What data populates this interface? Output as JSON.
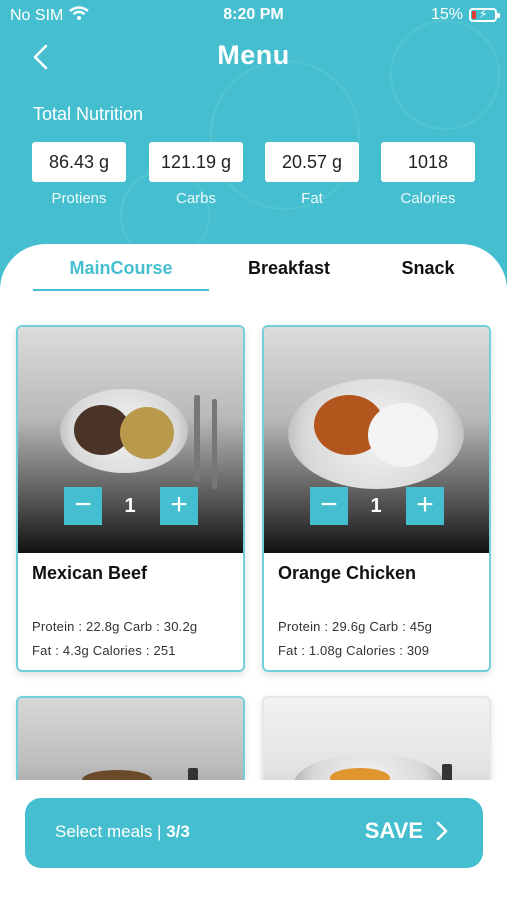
{
  "status_bar": {
    "carrier": "No SIM",
    "time": "8:20 PM",
    "battery": "15%"
  },
  "header": {
    "title": "Menu",
    "nutrition_heading": "Total Nutrition",
    "nutrition": [
      {
        "value": "86.43 g",
        "label": "Protiens"
      },
      {
        "value": "121.19 g",
        "label": "Carbs"
      },
      {
        "value": "20.57 g",
        "label": "Fat"
      },
      {
        "value": "1018",
        "label": "Calories"
      }
    ]
  },
  "tabs": [
    {
      "label": "MainCourse",
      "active": true
    },
    {
      "label": "Breakfast",
      "active": false
    },
    {
      "label": "Snack",
      "active": false
    }
  ],
  "meals": [
    {
      "name": "Mexican Beef",
      "quantity": "1",
      "info_line1": "Protein : 22.8g  Carb : 30.2g",
      "info_line2": "Fat : 4.3g  Calories : 251"
    },
    {
      "name": "Orange Chicken",
      "quantity": "1",
      "info_line1": "Protein : 29.6g  Carb : 45g",
      "info_line2": "Fat : 1.08g  Calories : 309"
    }
  ],
  "footer": {
    "select_text": "Select meals | ",
    "select_count": "3/3",
    "save_label": "SAVE"
  },
  "colors": {
    "accent": "#45bfcf"
  },
  "icons": {
    "back": "chevron-left-icon",
    "wifi": "wifi-icon",
    "battery": "battery-icon",
    "minus": "minus-icon",
    "plus": "plus-icon",
    "save_chevron": "chevron-right-icon"
  }
}
